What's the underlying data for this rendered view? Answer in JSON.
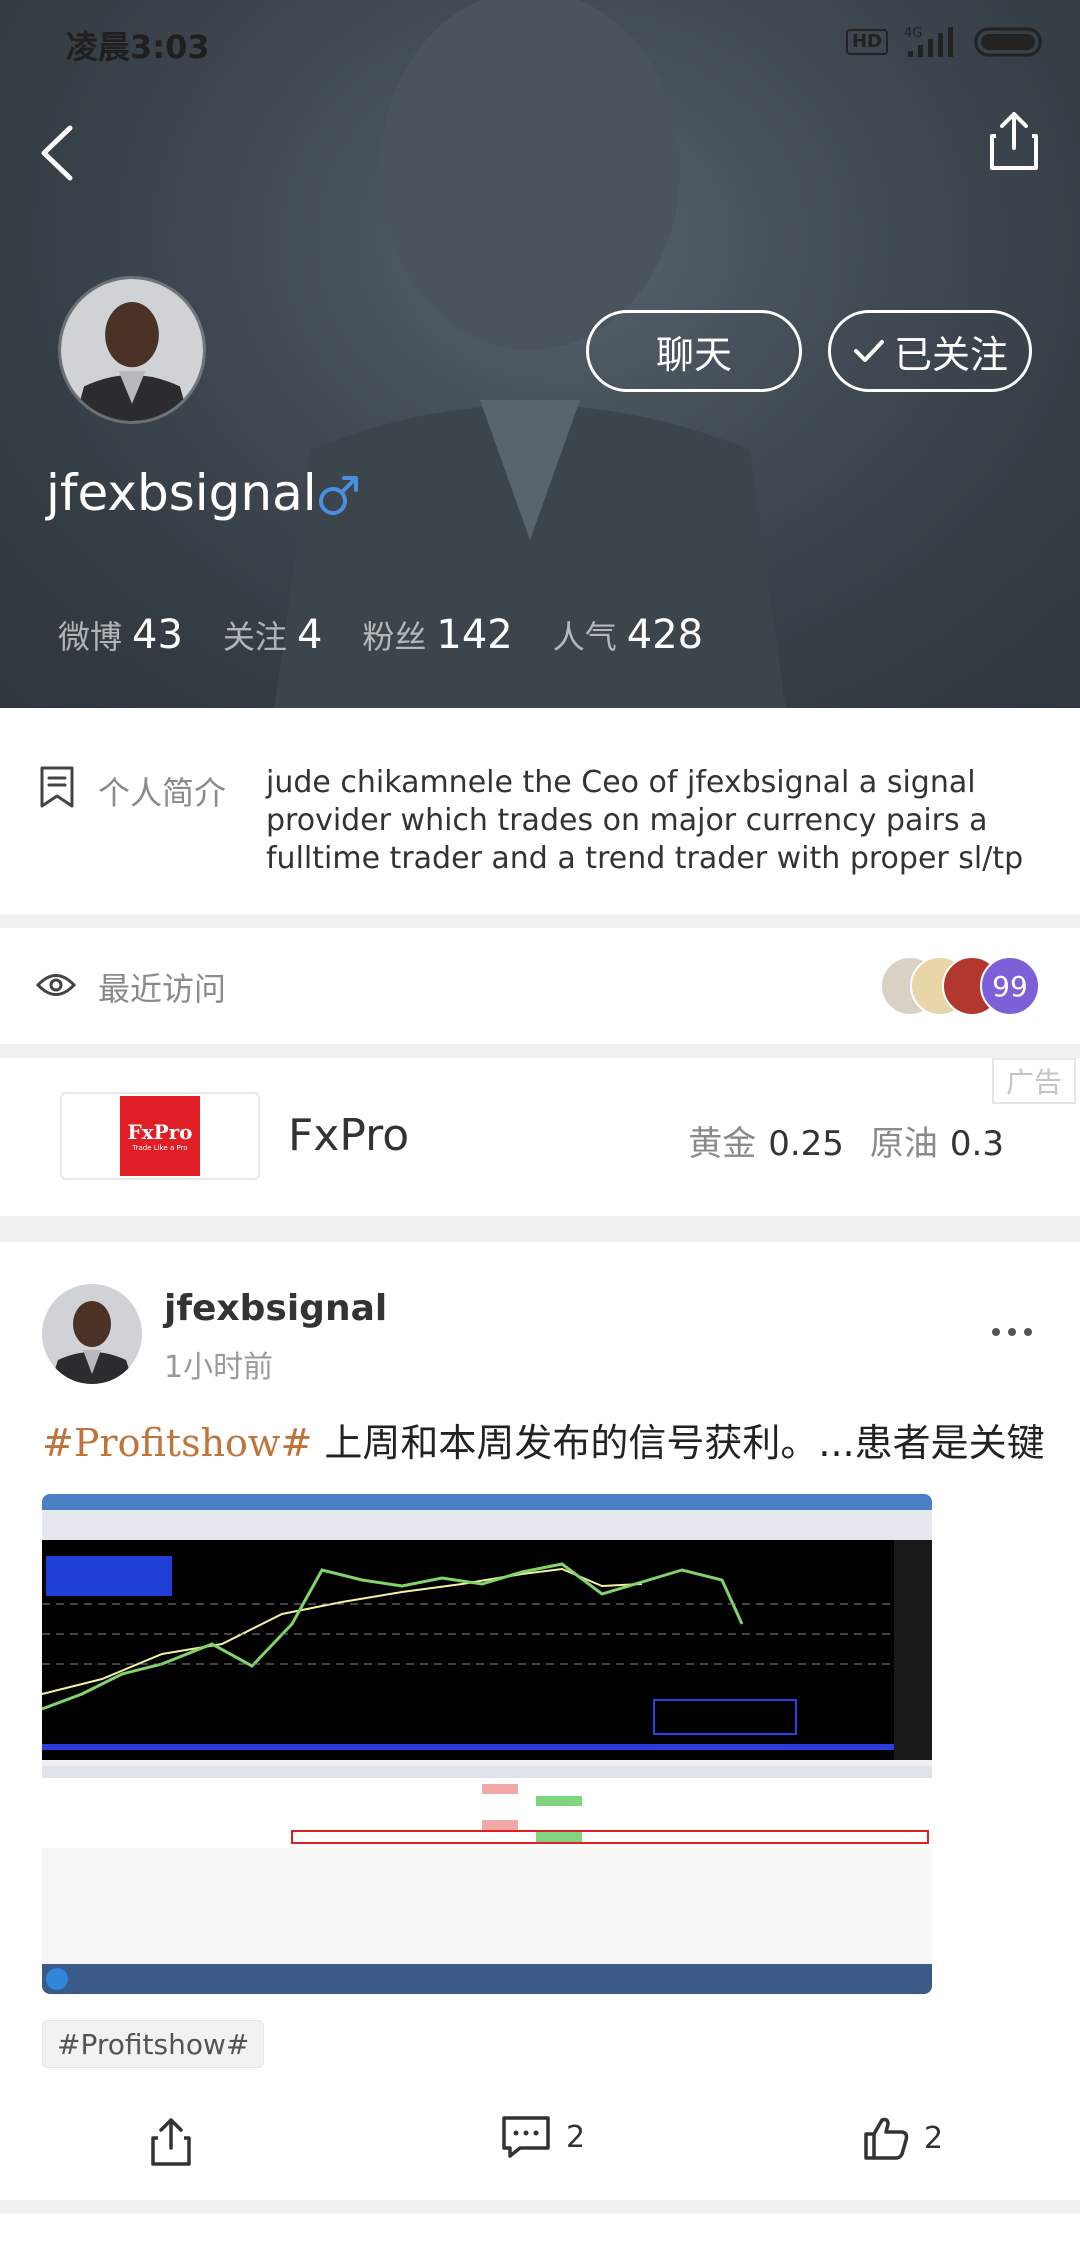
{
  "status_bar": {
    "time": "凌晨3:03",
    "hd": "HD",
    "network": "4G"
  },
  "profile": {
    "username": "jfexbsignal",
    "gender_icon": "male-icon",
    "chat_label": "聊天",
    "follow_label": "已关注",
    "stats": [
      {
        "label": "微博",
        "value": "43"
      },
      {
        "label": "关注",
        "value": "4"
      },
      {
        "label": "粉丝",
        "value": "142"
      },
      {
        "label": "人气",
        "value": "428"
      }
    ]
  },
  "bio": {
    "label": "个人简介",
    "text": "jude chikamnele the Ceo of jfexbsignal a signal provider which trades on major currency pairs a fulltime trader and a trend trader with proper sl/tp"
  },
  "visits": {
    "label": "最近访问",
    "count": "99"
  },
  "ad": {
    "tag": "广告",
    "logo_name": "FxPro",
    "logo_tagline": "Trade Like a Pro",
    "brand": "FxPro",
    "quotes": [
      {
        "label": "黄金",
        "value": "0.25"
      },
      {
        "label": "原油",
        "value": "0.3"
      }
    ]
  },
  "post": {
    "author": "jfexbsignal",
    "time": "1小时前",
    "hashtag": "#Profitshow#",
    "text": " 上周和本周发布的信号获利。...患者是关键",
    "topic": "#Profitshow#",
    "share_icon": "share-icon",
    "comment_count": "2",
    "like_count": "2"
  },
  "colors": {
    "accent_follow": "#4a90e2",
    "hashtag": "#c0733a",
    "visitor_badge": "#7d5fd8",
    "ad_red": "#e01e26"
  }
}
